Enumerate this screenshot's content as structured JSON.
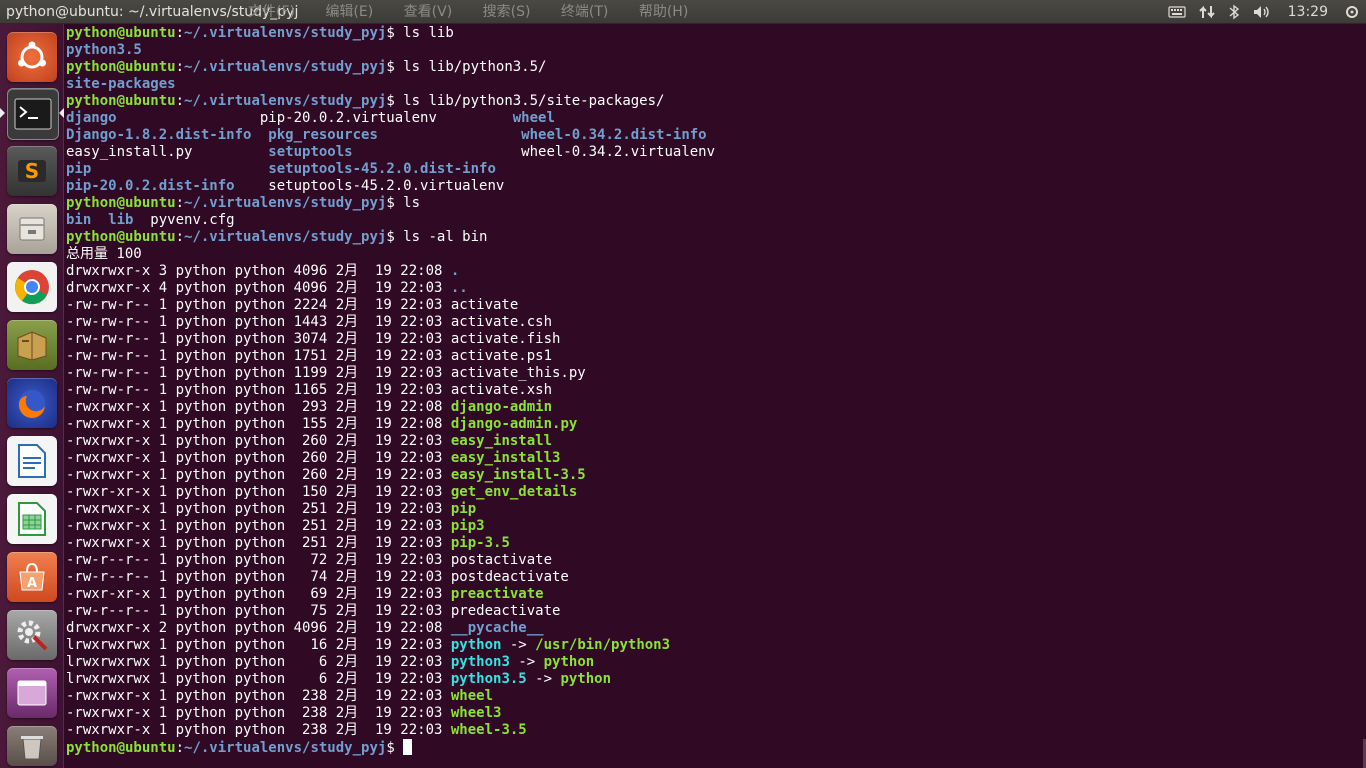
{
  "panel": {
    "title": "python@ubuntu: ~/.virtualenvs/study_pyj",
    "menu": [
      "文件(F)",
      "编辑(E)",
      "查看(V)",
      "搜索(S)",
      "终端(T)",
      "帮助(H)"
    ],
    "clock": "13:29",
    "indicators": [
      "keyboard-icon",
      "network-icon",
      "bluetooth-icon",
      "volume-icon"
    ]
  },
  "launcher": {
    "items": [
      {
        "name": "dash-ubuntu-icon",
        "color": "#e05a2a"
      },
      {
        "name": "terminal-icon",
        "color": "#2c2c2c",
        "active": true
      },
      {
        "name": "sublime-text-icon",
        "color": "#4a4a4a"
      },
      {
        "name": "files-icon",
        "color": "#c8c3b8"
      },
      {
        "name": "chrome-icon",
        "color": "#ffffff"
      },
      {
        "name": "book-icon",
        "color": "#6b8e23"
      },
      {
        "name": "firefox-icon",
        "color": "#e66000"
      },
      {
        "name": "libreoffice-writer-icon",
        "color": "#2a6ebb"
      },
      {
        "name": "libreoffice-calc-icon",
        "color": "#2e9a3c"
      },
      {
        "name": "software-center-icon",
        "color": "#e4663a"
      },
      {
        "name": "system-settings-icon",
        "color": "#b02525"
      },
      {
        "name": "workspace-switcher-icon",
        "color": "#8a3a8a"
      },
      {
        "name": "trash-icon",
        "color": "#9a8e88"
      }
    ]
  },
  "terminal": {
    "lines": [
      [
        [
          "user",
          "python@ubuntu"
        ],
        [
          "plain",
          ":"
        ],
        [
          "path",
          "~/.virtualenvs/study_pyj"
        ],
        [
          "plain",
          "$ ls lib"
        ]
      ],
      [
        [
          "dir",
          "python3.5"
        ]
      ],
      [
        [
          "user",
          "python@ubuntu"
        ],
        [
          "plain",
          ":"
        ],
        [
          "path",
          "~/.virtualenvs/study_pyj"
        ],
        [
          "plain",
          "$ ls lib/python3.5/"
        ]
      ],
      [
        [
          "dir",
          "site-packages"
        ]
      ],
      [
        [
          "user",
          "python@ubuntu"
        ],
        [
          "plain",
          ":"
        ],
        [
          "path",
          "~/.virtualenvs/study_pyj"
        ],
        [
          "plain",
          "$ ls lib/python3.5/site-packages/"
        ]
      ],
      [
        [
          "dir",
          "django"
        ],
        [
          "plain",
          "                 pip-20.0.2.virtualenv         "
        ],
        [
          "dir",
          "wheel"
        ]
      ],
      [
        [
          "dir",
          "Django-1.8.2.dist-info"
        ],
        [
          "plain",
          "  "
        ],
        [
          "dir",
          "pkg_resources"
        ],
        [
          "plain",
          "                 "
        ],
        [
          "dir",
          "wheel-0.34.2.dist-info"
        ]
      ],
      [
        [
          "plain",
          "easy_install.py         "
        ],
        [
          "dir",
          "setuptools"
        ],
        [
          "plain",
          "                    wheel-0.34.2.virtualenv"
        ]
      ],
      [
        [
          "dir",
          "pip"
        ],
        [
          "plain",
          "                     "
        ],
        [
          "dir",
          "setuptools-45.2.0.dist-info"
        ]
      ],
      [
        [
          "dir",
          "pip-20.0.2.dist-info"
        ],
        [
          "plain",
          "    setuptools-45.2.0.virtualenv"
        ]
      ],
      [
        [
          "user",
          "python@ubuntu"
        ],
        [
          "plain",
          ":"
        ],
        [
          "path",
          "~/.virtualenvs/study_pyj"
        ],
        [
          "plain",
          "$ ls"
        ]
      ],
      [
        [
          "dir",
          "bin"
        ],
        [
          "plain",
          "  "
        ],
        [
          "dir",
          "lib"
        ],
        [
          "plain",
          "  pyvenv.cfg"
        ]
      ],
      [
        [
          "user",
          "python@ubuntu"
        ],
        [
          "plain",
          ":"
        ],
        [
          "path",
          "~/.virtualenvs/study_pyj"
        ],
        [
          "plain",
          "$ ls -al bin"
        ]
      ],
      [
        [
          "plain",
          "总用量 100"
        ]
      ],
      [
        [
          "plain",
          "drwxrwxr-x 3 python python 4096 2月  19 22:08 "
        ],
        [
          "dir",
          "."
        ]
      ],
      [
        [
          "plain",
          "drwxrwxr-x 4 python python 4096 2月  19 22:03 "
        ],
        [
          "dir",
          ".."
        ]
      ],
      [
        [
          "plain",
          "-rw-rw-r-- 1 python python 2224 2月  19 22:03 activate"
        ]
      ],
      [
        [
          "plain",
          "-rw-rw-r-- 1 python python 1443 2月  19 22:03 activate.csh"
        ]
      ],
      [
        [
          "plain",
          "-rw-rw-r-- 1 python python 3074 2月  19 22:03 activate.fish"
        ]
      ],
      [
        [
          "plain",
          "-rw-rw-r-- 1 python python 1751 2月  19 22:03 activate.ps1"
        ]
      ],
      [
        [
          "plain",
          "-rw-rw-r-- 1 python python 1199 2月  19 22:03 activate_this.py"
        ]
      ],
      [
        [
          "plain",
          "-rw-rw-r-- 1 python python 1165 2月  19 22:03 activate.xsh"
        ]
      ],
      [
        [
          "plain",
          "-rwxrwxr-x 1 python python  293 2月  19 22:08 "
        ],
        [
          "exe",
          "django-admin"
        ]
      ],
      [
        [
          "plain",
          "-rwxrwxr-x 1 python python  155 2月  19 22:08 "
        ],
        [
          "exe",
          "django-admin.py"
        ]
      ],
      [
        [
          "plain",
          "-rwxrwxr-x 1 python python  260 2月  19 22:03 "
        ],
        [
          "exe",
          "easy_install"
        ]
      ],
      [
        [
          "plain",
          "-rwxrwxr-x 1 python python  260 2月  19 22:03 "
        ],
        [
          "exe",
          "easy_install3"
        ]
      ],
      [
        [
          "plain",
          "-rwxrwxr-x 1 python python  260 2月  19 22:03 "
        ],
        [
          "exe",
          "easy_install-3.5"
        ]
      ],
      [
        [
          "plain",
          "-rwxr-xr-x 1 python python  150 2月  19 22:03 "
        ],
        [
          "exe",
          "get_env_details"
        ]
      ],
      [
        [
          "plain",
          "-rwxrwxr-x 1 python python  251 2月  19 22:03 "
        ],
        [
          "exe",
          "pip"
        ]
      ],
      [
        [
          "plain",
          "-rwxrwxr-x 1 python python  251 2月  19 22:03 "
        ],
        [
          "exe",
          "pip3"
        ]
      ],
      [
        [
          "plain",
          "-rwxrwxr-x 1 python python  251 2月  19 22:03 "
        ],
        [
          "exe",
          "pip-3.5"
        ]
      ],
      [
        [
          "plain",
          "-rw-r--r-- 1 python python   72 2月  19 22:03 postactivate"
        ]
      ],
      [
        [
          "plain",
          "-rw-r--r-- 1 python python   74 2月  19 22:03 postdeactivate"
        ]
      ],
      [
        [
          "plain",
          "-rwxr-xr-x 1 python python   69 2月  19 22:03 "
        ],
        [
          "exe",
          "preactivate"
        ]
      ],
      [
        [
          "plain",
          "-rw-r--r-- 1 python python   75 2月  19 22:03 predeactivate"
        ]
      ],
      [
        [
          "plain",
          "drwxrwxr-x 2 python python 4096 2月  19 22:08 "
        ],
        [
          "dir",
          "__pycache__"
        ]
      ],
      [
        [
          "plain",
          "lrwxrwxrwx 1 python python   16 2月  19 22:03 "
        ],
        [
          "lnk",
          "python"
        ],
        [
          "plain",
          " -> "
        ],
        [
          "exe",
          "/usr/bin/python3"
        ]
      ],
      [
        [
          "plain",
          "lrwxrwxrwx 1 python python    6 2月  19 22:03 "
        ],
        [
          "lnk",
          "python3"
        ],
        [
          "plain",
          " -> "
        ],
        [
          "exe",
          "python"
        ]
      ],
      [
        [
          "plain",
          "lrwxrwxrwx 1 python python    6 2月  19 22:03 "
        ],
        [
          "lnk",
          "python3.5"
        ],
        [
          "plain",
          " -> "
        ],
        [
          "exe",
          "python"
        ]
      ],
      [
        [
          "plain",
          "-rwxrwxr-x 1 python python  238 2月  19 22:03 "
        ],
        [
          "exe",
          "wheel"
        ]
      ],
      [
        [
          "plain",
          "-rwxrwxr-x 1 python python  238 2月  19 22:03 "
        ],
        [
          "exe",
          "wheel3"
        ]
      ],
      [
        [
          "plain",
          "-rwxrwxr-x 1 python python  238 2月  19 22:03 "
        ],
        [
          "exe",
          "wheel-3.5"
        ]
      ],
      [
        [
          "user",
          "python@ubuntu"
        ],
        [
          "plain",
          ":"
        ],
        [
          "path",
          "~/.virtualenvs/study_pyj"
        ],
        [
          "plain",
          "$ "
        ]
      ]
    ]
  }
}
